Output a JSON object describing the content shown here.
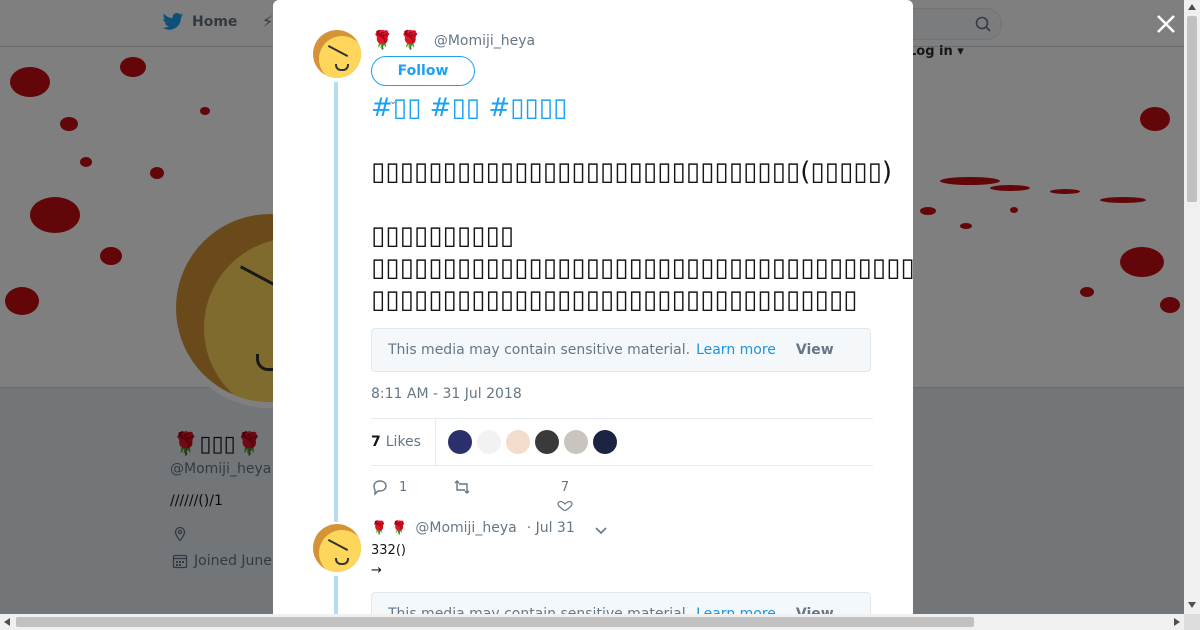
{
  "topbar": {
    "home_label": "Home",
    "login_label": "Log in",
    "moments_glyph": "⚡"
  },
  "profile": {
    "name": "🌹▯▯▯🌹",
    "handle": "@Momiji_heya",
    "bio": "//////()/1",
    "joined": "Joined June"
  },
  "colors": {
    "accent": "#1da1f2",
    "blood": "#c40d12",
    "thread": "#b7dcf1"
  },
  "tweet": {
    "roses": "🌹🌹",
    "handle": "@Momiji_heya",
    "follow_label": "Follow",
    "caret": "⌄",
    "hashtags": "#▯▯ #▯▯ #▯▯▯▯",
    "body_line1": "▯▯▯▯▯▯▯▯▯▯▯▯▯▯▯▯▯▯▯▯▯▯▯▯▯▯▯▯▯▯(▯▯▯▯▯)",
    "body_line2": "▯▯▯▯▯▯▯▯▯▯",
    "body_line3": "▯▯▯▯▯▯▯▯▯▯▯▯▯▯▯▯▯▯▯▯▯▯▯▯▯▯▯▯▯▯▯▯▯▯▯▯▯▯▯▯▯▯▯▯▯▯▯▯▯(DM)▯▯▯▯▯▯▯▯▯▯▯▯▯▯",
    "body_line4": "▯▯▯▯▯▯▯▯▯▯▯▯▯▯▯▯▯▯▯▯▯▯▯▯▯▯▯▯▯▯▯▯▯▯",
    "sensitive_text": "This media may contain sensitive material.",
    "learn_more": "Learn more",
    "view_label": "View",
    "timestamp": "8:11 AM - 31 Jul 2018",
    "likes_count": "7",
    "likes_label": "Likes",
    "likers": [
      "#2b2f6b",
      "#f2f2f2",
      "#f4dccb",
      "#3a3a3a",
      "#c9c4bd",
      "#1b2440"
    ],
    "reply_count": "1",
    "like_count": "7"
  },
  "tweet2": {
    "roses": "🌹🌹",
    "handle": "@Momiji_heya",
    "date": "· Jul 31",
    "line1": "332()",
    "line2": "→",
    "sensitive_text": "This media may contain sensitive material.",
    "learn_more": "Learn more",
    "view_label": "View"
  }
}
